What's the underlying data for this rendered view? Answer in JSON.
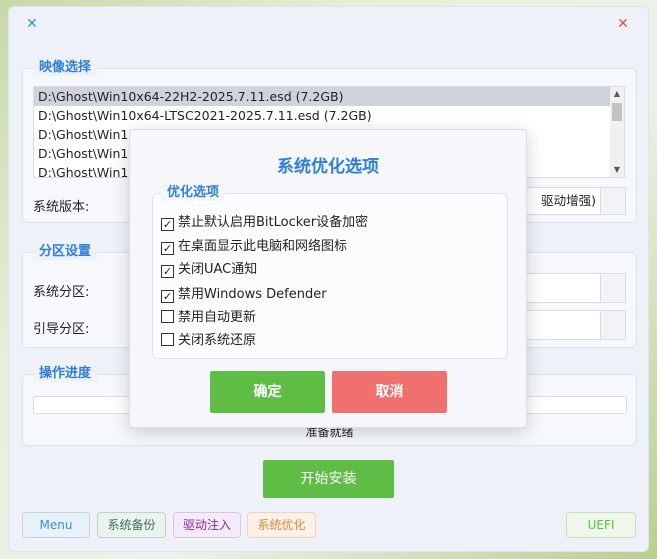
{
  "title_bar": {
    "app_icon": "x-logo-icon",
    "close_icon": "close-icon"
  },
  "image_group": {
    "title": "映像选择",
    "images": [
      "D:\\Ghost\\Win10x64-22H2-2025.7.11.esd (7.2GB)",
      "D:\\Ghost\\Win10x64-LTSC2021-2025.7.11.esd (7.2GB)",
      "D:\\Ghost\\Win11",
      "D:\\Ghost\\Win11",
      "D:\\Ghost\\Win11"
    ],
    "selected_index": 0,
    "version_label": "系统版本:",
    "version_value_partial": "驱动增强)"
  },
  "partition_group": {
    "title": "分区设置",
    "system_label": "系统分区:",
    "boot_label": "引导分区:"
  },
  "progress_group": {
    "title": "操作进度",
    "status_text": "准备就绪",
    "progress": 0
  },
  "start_button": "开始安装",
  "bottom_buttons": {
    "menu": "Menu",
    "backup": "系统备份",
    "driver": "驱动注入",
    "optimize": "系统优化",
    "uefi": "UEFI"
  },
  "dialog": {
    "title": "系统优化选项",
    "group_title": "优化选项",
    "options": [
      {
        "label": "禁止默认启用BitLocker设备加密",
        "checked": true
      },
      {
        "label": "在桌面显示此电脑和网络图标",
        "checked": true
      },
      {
        "label": "关闭UAC通知",
        "checked": true
      },
      {
        "label": "禁用Windows Defender",
        "checked": true
      },
      {
        "label": "禁用自动更新",
        "checked": false
      },
      {
        "label": "关闭系统还原",
        "checked": false
      }
    ],
    "ok": "确定",
    "cancel": "取消"
  },
  "colors": {
    "accent": "#2f7fd8",
    "ok_button": "#5fbd45",
    "cancel_button": "#f07070",
    "close": "#e0524a"
  }
}
